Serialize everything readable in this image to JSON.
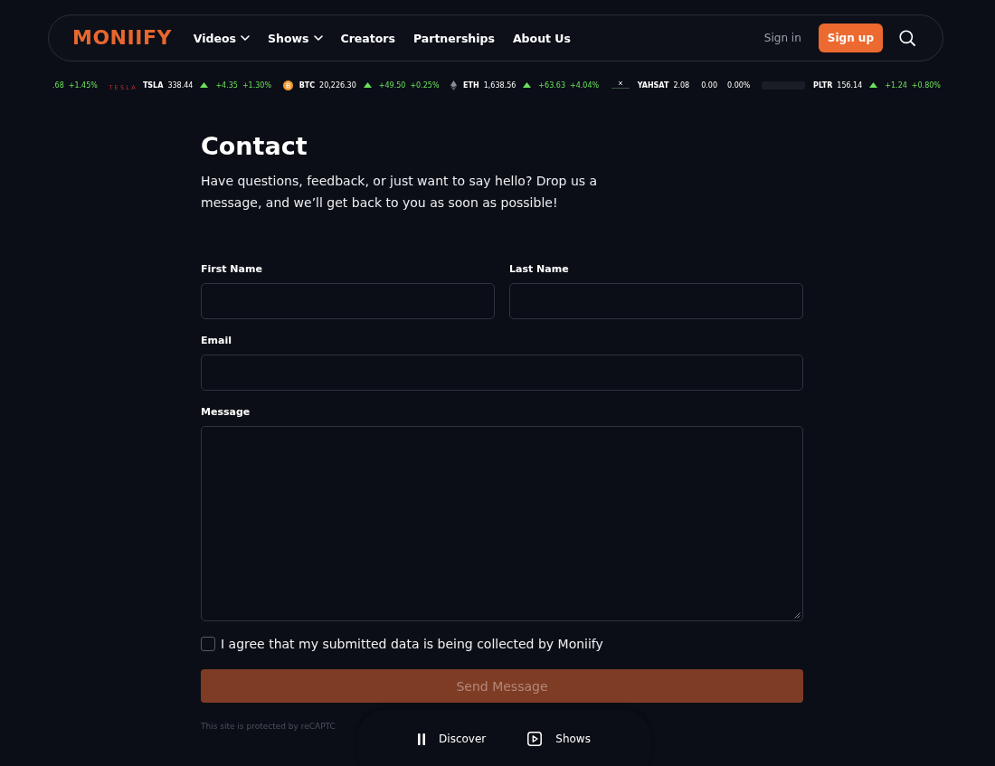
{
  "header": {
    "logo": "MONIIFY",
    "nav": [
      {
        "label": "Videos",
        "dropdown": true
      },
      {
        "label": "Shows",
        "dropdown": true
      },
      {
        "label": "Creators",
        "dropdown": false
      },
      {
        "label": "Partnerships",
        "dropdown": false
      },
      {
        "label": "About Us",
        "dropdown": false
      }
    ],
    "sign_in": "Sign in",
    "sign_up": "Sign up"
  },
  "ticker": [
    {
      "change": ".68",
      "percent": "+1.45%",
      "up": true
    },
    {
      "logo": {
        "kind": "wordmark",
        "text": "TESLA"
      },
      "symbol": "TSLA",
      "price": "338.44",
      "change": "+4.35",
      "percent": "+1.30%",
      "up": true
    },
    {
      "logo": {
        "kind": "bitcoin"
      },
      "symbol": "BTC",
      "price": "20,226.30",
      "change": "+49.50",
      "percent": "+0.25%",
      "up": true
    },
    {
      "logo": {
        "kind": "ethereum"
      },
      "symbol": "ETH",
      "price": "1,638.56",
      "change": "+63.63",
      "percent": "+4.04%",
      "up": true
    },
    {
      "logo": {
        "kind": "satellite"
      },
      "symbol": "YAHSAT",
      "price": "2.08",
      "change": "0.00",
      "percent": "0.00%",
      "up": false
    },
    {
      "logo": {
        "kind": "faded"
      },
      "symbol": "PLTR",
      "price": "156.14",
      "change": "+1.24",
      "percent": "+0.80%",
      "up": true
    }
  ],
  "contact": {
    "title": "Contact",
    "intro": "Have questions, feedback, or just want to say hello? Drop us a message, and we’ll get back to you as soon as possible!",
    "rows": [
      [
        {
          "label": "First Name",
          "kind": "text"
        },
        {
          "label": "Last Name",
          "kind": "text"
        }
      ],
      [
        {
          "label": "Email",
          "kind": "text"
        }
      ],
      [
        {
          "label": "Message",
          "kind": "textarea"
        }
      ]
    ],
    "consent": {
      "label": "I agree that my submitted data is being collected by Moniify",
      "checked": false
    },
    "submit": {
      "label": "Send Message",
      "disabled": true
    },
    "recaptcha_note": "This site is protected by reCAPTC"
  },
  "bottom_nav": [
    {
      "label": "Discover",
      "kind": "pause"
    },
    {
      "label": "Shows",
      "kind": "play"
    }
  ]
}
